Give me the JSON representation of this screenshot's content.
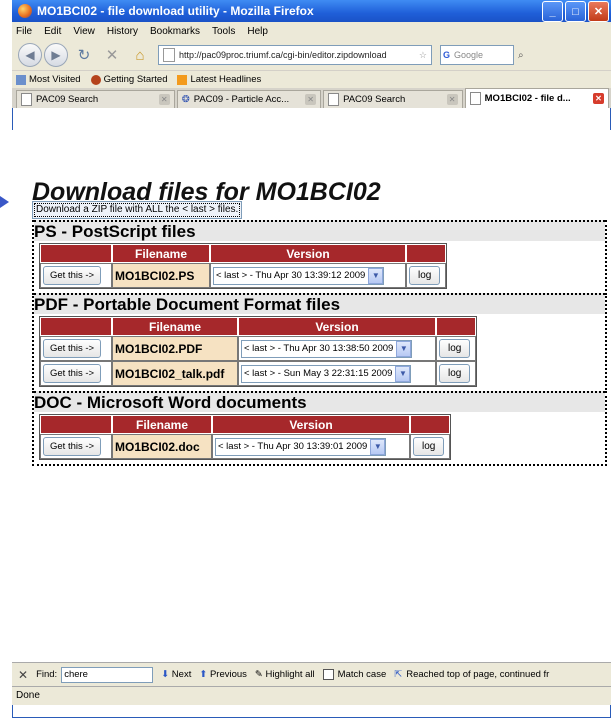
{
  "window": {
    "title": "MO1BCI02 - file download utility - Mozilla Firefox"
  },
  "menu": [
    "File",
    "Edit",
    "View",
    "History",
    "Bookmarks",
    "Tools",
    "Help"
  ],
  "nav": {
    "url": "http://pac09proc.triumf.ca/cgi-bin/editor.zipdownload",
    "search_engine": "G",
    "search_placeholder": "Google"
  },
  "bookmarks": [
    "Most Visited",
    "Getting Started",
    "Latest Headlines"
  ],
  "tabs": [
    "PAC09 Search",
    "PAC09 - Particle Acc...",
    "PAC09 Search",
    "MO1BCI02 - file d..."
  ],
  "page": {
    "title": "Download files for MO1BCI02",
    "zip_button": "Download a ZIP file with ALL the < last > files.",
    "get_label": "Get this ->",
    "log_label": "log",
    "col_filename": "Filename",
    "col_version": "Version",
    "groups": [
      {
        "title": "PS - PostScript files",
        "rows": [
          {
            "file": "MO1BCI02.PS",
            "version": "< last > - Thu Apr 30 13:39:12 2009"
          }
        ]
      },
      {
        "title": "PDF - Portable Document Format files",
        "rows": [
          {
            "file": "MO1BCI02.PDF",
            "version": "< last > - Thu Apr 30 13:38:50 2009"
          },
          {
            "file": "MO1BCI02_talk.pdf",
            "version": "< last > - Sun May 3 22:31:15 2009"
          }
        ]
      },
      {
        "title": "DOC - Microsoft Word documents",
        "rows": [
          {
            "file": "MO1BCI02.doc",
            "version": "< last > - Thu Apr 30 13:39:01 2009"
          }
        ]
      }
    ]
  },
  "findbar": {
    "label": "Find:",
    "value": "chere",
    "next": "Next",
    "previous": "Previous",
    "highlight": "Highlight all",
    "match_case": "Match case",
    "message": "Reached top of page, continued fr"
  },
  "status": "Done"
}
